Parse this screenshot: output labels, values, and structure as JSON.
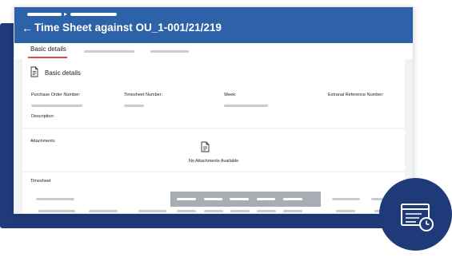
{
  "header": {
    "back_arrow": "←",
    "breadcrumb_separator": "▸",
    "title": "Time Sheet against OU_1-001/21/219"
  },
  "tabs": {
    "active_label": "Basic details"
  },
  "basic_details": {
    "section_title": "Basic details",
    "fields": {
      "purchase_order_number": "Purchase Order Number:",
      "timesheet_number": "Timesheet Number:",
      "week": "Week:",
      "external_reference_number": "Extranal Reference Number:",
      "description": "Description:"
    }
  },
  "attachments": {
    "title": "Attachments",
    "empty_message": "No Attachments Available"
  },
  "timesheet": {
    "title": "Timesheet"
  },
  "icons": {
    "header": "back-arrow-icon",
    "section": "document-icon",
    "attachments": "attachment-document-icon",
    "badge": "timesheet-clock-icon"
  },
  "colors": {
    "header_bg": "#2d62a8",
    "back_panel": "#1e3a78",
    "tab_underline": "#d84a4a",
    "placeholder": "#c9ccd2",
    "table_header": "#a9adb3"
  }
}
